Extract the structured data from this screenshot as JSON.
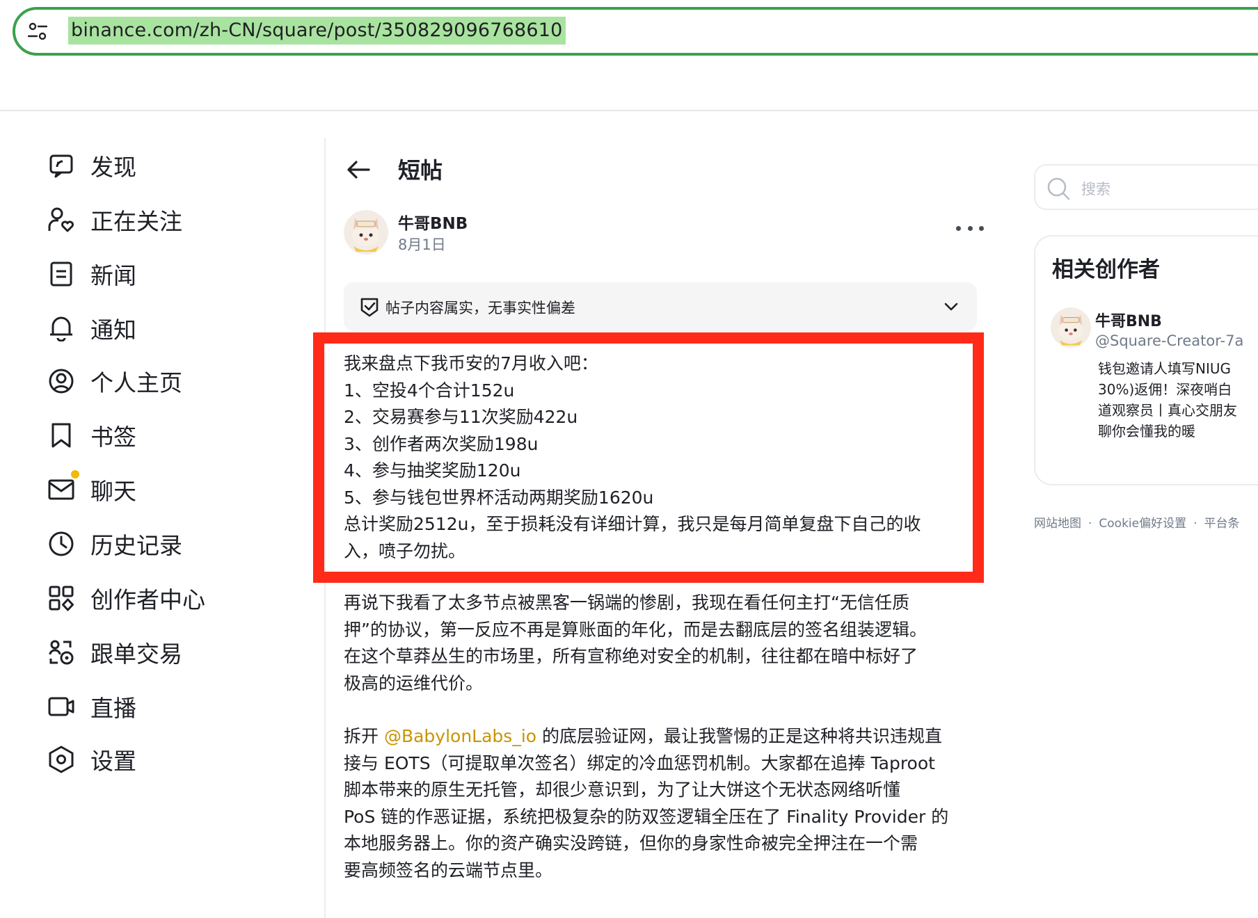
{
  "browser": {
    "url": "binance.com/zh-CN/square/post/350829096768610"
  },
  "sidebar": {
    "items": [
      {
        "label": "发现",
        "icon": "discover-icon"
      },
      {
        "label": "正在关注",
        "icon": "following-icon"
      },
      {
        "label": "新闻",
        "icon": "news-icon"
      },
      {
        "label": "通知",
        "icon": "bell-icon"
      },
      {
        "label": "个人主页",
        "icon": "profile-icon"
      },
      {
        "label": "书签",
        "icon": "bookmark-icon"
      },
      {
        "label": "聊天",
        "icon": "mail-icon"
      },
      {
        "label": "历史记录",
        "icon": "clock-icon"
      },
      {
        "label": "创作者中心",
        "icon": "grid-icon"
      },
      {
        "label": "跟单交易",
        "icon": "copy-trade-icon"
      },
      {
        "label": "直播",
        "icon": "video-icon"
      },
      {
        "label": "设置",
        "icon": "settings-icon"
      }
    ]
  },
  "main": {
    "title": "短帖",
    "author": {
      "name": "牛哥BNB",
      "date": "8月1日"
    },
    "fact_check": "帖子内容属实，无事实性偏差",
    "highlight_lines": [
      "我来盘点下我币安的7月收入吧：",
      "1、空投4个合计152u",
      "2、交易赛参与11次奖励422u",
      "3、创作者两次奖励198u",
      "4、参与抽奖奖励120u",
      "5、参与钱包世界杯活动两期奖励1620u",
      "总计奖励2512u，至于损耗没有详细计算，我只是每月简单复盘下自己的收",
      "入，喷子勿扰。"
    ],
    "para1_lines": [
      "再说下我看了太多节点被黑客一锅端的惨剧，我现在看任何主打“无信任质",
      "押”的协议，第一反应不再是算账面的年化，而是去翻底层的签名组装逻辑。",
      "在这个草莽丛生的市场里，所有宣称绝对安全的机制，往往都在暗中标好了",
      "极高的运维代价。"
    ],
    "para2_first_prefix": "拆开 ",
    "para2_mention": "@BabylonLabs_io",
    "para2_first_suffix": " 的底层验证网，最让我警惕的正是这种将共识违规直",
    "para2_lines": [
      "接与 EOTS（可提取单次签名）绑定的冷血惩罚机制。大家都在追捧 Taproot",
      "脚本带来的原生无托管，却很少意识到，为了让大饼这个无状态网络听懂",
      "PoS 链的作恶证据，系统把极复杂的防双签逻辑全压在了 Finality Provider 的",
      "本地服务器上。你的资产确实没跨链，但你的身家性命被完全押注在一个需",
      "要高频签名的云端节点里。"
    ]
  },
  "right": {
    "search_placeholder": "搜索",
    "creators_title": "相关创作者",
    "creator": {
      "name": "牛哥BNB",
      "handle": "@Square-Creator-7a",
      "bio_lines": [
        "钱包邀请人填写NIUG",
        "30%)返佣！深夜哨白",
        "道观察员丨真心交朋友",
        "聊你会懂我的暖"
      ]
    },
    "footer": [
      "网站地图",
      "Cookie偏好设置",
      "平台条"
    ]
  },
  "colors": {
    "accent": "#f0b90b",
    "mention": "#c99400",
    "highlight_border": "#ff2a18",
    "url_highlight": "#a9e3a0",
    "address_border": "#3aa24b"
  }
}
